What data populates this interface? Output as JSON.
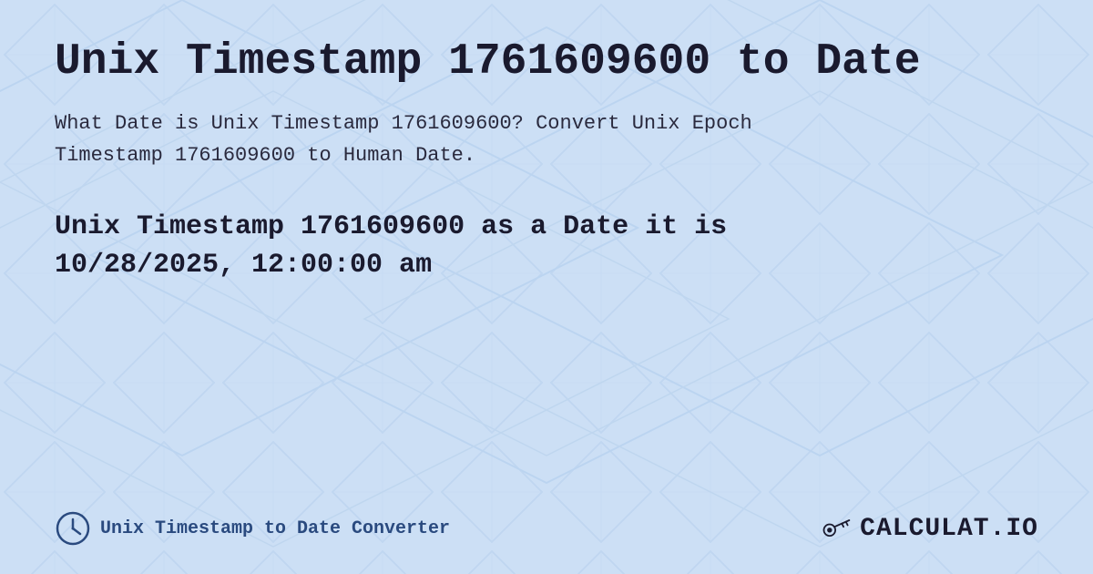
{
  "page": {
    "title": "Unix Timestamp 1761609600 to Date",
    "description_line1": "What Date is Unix Timestamp 1761609600? Convert Unix Epoch",
    "description_line2": "Timestamp 1761609600 to Human Date.",
    "result_line1": "Unix Timestamp 1761609600 as a Date it is",
    "result_line2": "10/28/2025, 12:00:00 am",
    "footer_label": "Unix Timestamp to Date Converter",
    "logo_text": "CALCULAT.IO"
  }
}
